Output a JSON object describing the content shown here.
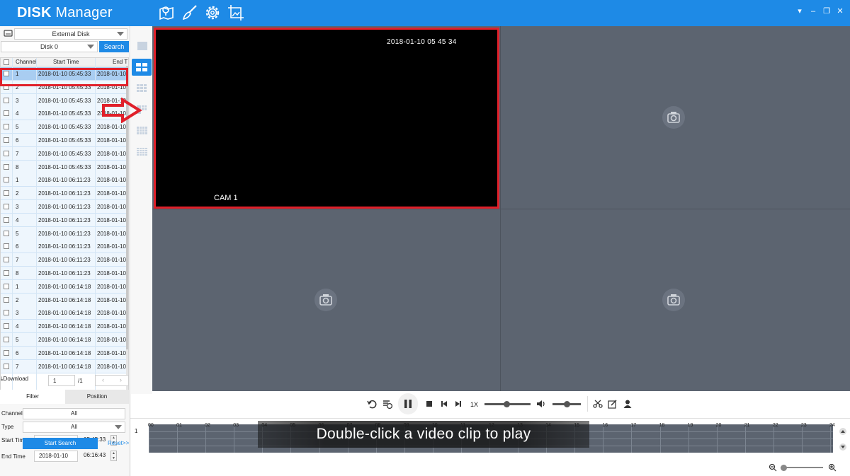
{
  "app": {
    "title_bold": "DISK",
    "title_rest": " Manager",
    "accent": "#1e8ae6",
    "toolbar_icons": [
      "map-pin-icon",
      "brush-icon",
      "gear-icon",
      "image-crop-icon"
    ],
    "window_controls": [
      "menu-icon",
      "minimize-icon",
      "restore-icon",
      "close-icon"
    ]
  },
  "left_panel": {
    "device_select": "External Disk",
    "disk_select": "Disk 0",
    "search_label": "Search",
    "columns": [
      "Channel",
      "Start Time",
      "End T"
    ],
    "rows": [
      {
        "channel": "1",
        "start": "2018-01-10 05:45:33",
        "end": "2018-01-10",
        "selected": true
      },
      {
        "channel": "2",
        "start": "2018-01-10 05:45:33",
        "end": "2018-01-10",
        "selected": false
      },
      {
        "channel": "3",
        "start": "2018-01-10 05:45:33",
        "end": "2018-01-10",
        "selected": false
      },
      {
        "channel": "4",
        "start": "2018-01-10 05:45:33",
        "end": "2018-01-10",
        "selected": false
      },
      {
        "channel": "5",
        "start": "2018-01-10 05:45:33",
        "end": "2018-01-10",
        "selected": false
      },
      {
        "channel": "6",
        "start": "2018-01-10 05:45:33",
        "end": "2018-01-10",
        "selected": false
      },
      {
        "channel": "7",
        "start": "2018-01-10 05:45:33",
        "end": "2018-01-10",
        "selected": false
      },
      {
        "channel": "8",
        "start": "2018-01-10 05:45:33",
        "end": "2018-01-10",
        "selected": false
      },
      {
        "channel": "1",
        "start": "2018-01-10 06:11:23",
        "end": "2018-01-10",
        "selected": false
      },
      {
        "channel": "2",
        "start": "2018-01-10 06:11:23",
        "end": "2018-01-10",
        "selected": false
      },
      {
        "channel": "3",
        "start": "2018-01-10 06:11:23",
        "end": "2018-01-10",
        "selected": false
      },
      {
        "channel": "4",
        "start": "2018-01-10 06:11:23",
        "end": "2018-01-10",
        "selected": false
      },
      {
        "channel": "5",
        "start": "2018-01-10 06:11:23",
        "end": "2018-01-10",
        "selected": false
      },
      {
        "channel": "6",
        "start": "2018-01-10 06:11:23",
        "end": "2018-01-10",
        "selected": false
      },
      {
        "channel": "7",
        "start": "2018-01-10 06:11:23",
        "end": "2018-01-10",
        "selected": false
      },
      {
        "channel": "8",
        "start": "2018-01-10 06:11:23",
        "end": "2018-01-10",
        "selected": false
      },
      {
        "channel": "1",
        "start": "2018-01-10 06:14:18",
        "end": "2018-01-10",
        "selected": false
      },
      {
        "channel": "2",
        "start": "2018-01-10 06:14:18",
        "end": "2018-01-10",
        "selected": false
      },
      {
        "channel": "3",
        "start": "2018-01-10 06:14:18",
        "end": "2018-01-10",
        "selected": false
      },
      {
        "channel": "4",
        "start": "2018-01-10 06:14:18",
        "end": "2018-01-10",
        "selected": false
      },
      {
        "channel": "5",
        "start": "2018-01-10 06:14:18",
        "end": "2018-01-10",
        "selected": false
      },
      {
        "channel": "6",
        "start": "2018-01-10 06:14:18",
        "end": "2018-01-10",
        "selected": false
      },
      {
        "channel": "7",
        "start": "2018-01-10 06:14:18",
        "end": "2018-01-10",
        "selected": false
      }
    ],
    "download_label": "Download",
    "page_value": "1",
    "page_total": "/1",
    "tabs": [
      "Filter",
      "Position"
    ],
    "filter": {
      "channel_label": "Channel",
      "channel_value": "All",
      "type_label": "Type",
      "type_value": "All",
      "start_label": "Start Time",
      "start_date": "2018-01-10",
      "start_time": "05:45:33",
      "end_label": "End Time",
      "end_date": "2018-01-10",
      "end_time": "06:16:43"
    },
    "start_search_label": "Start Search",
    "reset_label": "Reset>>"
  },
  "layout_icons": [
    "layout-1-icon",
    "layout-4-icon",
    "layout-9-icon",
    "layout-12-icon",
    "layout-16-icon",
    "layout-25-icon"
  ],
  "video": {
    "cam1_timestamp": "2018-01-10 05 45 34",
    "cam1_name": "CAM 1",
    "highlight_color": "#e0202a"
  },
  "controls": {
    "speed": "1X",
    "icons": [
      "undo-icon",
      "sync-play-icon",
      "pause-icon",
      "stop-icon",
      "prev-frame-icon",
      "next-frame-icon",
      "volume-icon",
      "scissors-icon",
      "edit-icon",
      "user-icon"
    ]
  },
  "timeline": {
    "channel": "1",
    "hours": [
      "00",
      "01",
      "02",
      "03",
      "04",
      "05",
      "06",
      "07",
      "08",
      "09",
      "10",
      "11",
      "12",
      "13",
      "14",
      "15",
      "16",
      "17",
      "18",
      "19",
      "20",
      "21",
      "22",
      "23",
      "24"
    ]
  },
  "caption": "Double-click a video clip to play"
}
